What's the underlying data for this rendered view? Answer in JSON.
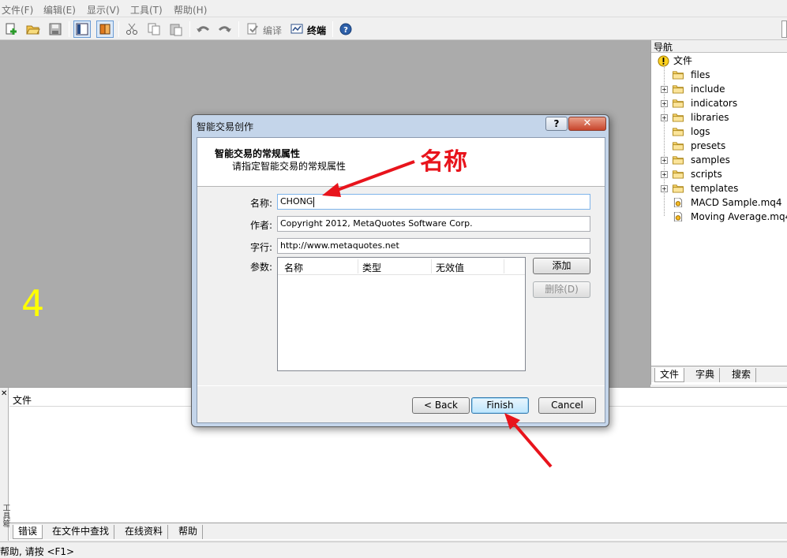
{
  "menu": [
    "文件(F)",
    "编辑(E)",
    "显示(V)",
    "工具(T)",
    "帮助(H)"
  ],
  "toolbar": {
    "compile_label": "编译",
    "terminal_label": "终端",
    "icons": [
      "new-file-icon",
      "open-folder-icon",
      "save-icon",
      "navigator-toggle-icon",
      "book-icon",
      "cut-icon",
      "copy-icon",
      "paste-icon",
      "undo-icon",
      "redo-icon",
      "compile-icon",
      "terminal-icon",
      "help-icon"
    ]
  },
  "workspace": {
    "big_number": "4"
  },
  "navigator": {
    "title": "导航",
    "root": "文件",
    "items": [
      {
        "label": "files",
        "expandable": false,
        "type": "folder"
      },
      {
        "label": "include",
        "expandable": true,
        "type": "folder"
      },
      {
        "label": "indicators",
        "expandable": true,
        "type": "folder"
      },
      {
        "label": "libraries",
        "expandable": true,
        "type": "folder"
      },
      {
        "label": "logs",
        "expandable": false,
        "type": "folder"
      },
      {
        "label": "presets",
        "expandable": false,
        "type": "folder"
      },
      {
        "label": "samples",
        "expandable": true,
        "type": "folder"
      },
      {
        "label": "scripts",
        "expandable": true,
        "type": "folder"
      },
      {
        "label": "templates",
        "expandable": true,
        "type": "folder"
      },
      {
        "label": "MACD Sample.mq4",
        "expandable": false,
        "type": "file"
      },
      {
        "label": "Moving Average.mq4",
        "expandable": false,
        "type": "file"
      }
    ],
    "tabs": [
      "文件",
      "字典",
      "搜索"
    ]
  },
  "terminal": {
    "header": "文件",
    "side_label": "工具箱",
    "tabs": [
      "错误",
      "在文件中查找",
      "在线资料",
      "帮助"
    ]
  },
  "status": {
    "text": "帮助, 请按 <F1>"
  },
  "dialog": {
    "title": "智能交易创作",
    "help_button": "?",
    "close_button": "✕",
    "heading": "智能交易的常规属性",
    "subheading": "请指定智能交易的常规属性",
    "fields": {
      "name_label": "名称:",
      "name_value": "CHONG",
      "author_label": "作者:",
      "author_value": "Copyright 2012, MetaQuotes Software Corp.",
      "link_label": "字行:",
      "link_value": "http://www.metaquotes.net",
      "params_label": "参数:"
    },
    "params_columns": [
      "名称",
      "类型",
      "无效值"
    ],
    "add_button": "添加",
    "delete_button": "删除(D)",
    "back_button": "< Back",
    "finish_button": "Finish",
    "cancel_button": "Cancel"
  },
  "annotation": {
    "text": "名称",
    "color": "#e8141c"
  },
  "colors": {
    "workspace_bg": "#ababab",
    "big_number": "#ffff00",
    "annotation_red": "#e8141c"
  }
}
